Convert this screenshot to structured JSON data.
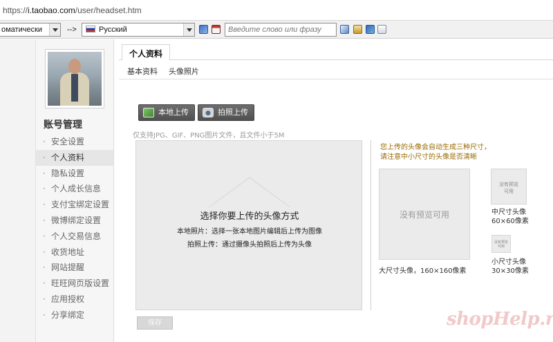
{
  "browser": {
    "url_prefix": "https://",
    "url_domain": "i.taobao.com",
    "url_path": "/user/headset.htm"
  },
  "translator_bar": {
    "source_lang": "оматически",
    "arrow": "-->",
    "target_lang": "Русский",
    "search_placeholder": "Введите слово или фразу"
  },
  "sidebar": {
    "title": "账号管理",
    "items": [
      {
        "label": "安全设置",
        "active": false
      },
      {
        "label": "个人资料",
        "active": true
      },
      {
        "label": "隐私设置",
        "active": false
      },
      {
        "label": "个人成长信息",
        "active": false
      },
      {
        "label": "支付宝绑定设置",
        "active": false
      },
      {
        "label": "微博绑定设置",
        "active": false
      },
      {
        "label": "个人交易信息",
        "active": false
      },
      {
        "label": "收货地址",
        "active": false
      },
      {
        "label": "网站提醒",
        "active": false
      },
      {
        "label": "旺旺网页版设置",
        "active": false
      },
      {
        "label": "应用授权",
        "active": false
      },
      {
        "label": "分享绑定",
        "active": false
      }
    ]
  },
  "main": {
    "tab": "个人资料",
    "subtabs": [
      "基本资料",
      "头像照片"
    ],
    "buttons": {
      "local_upload": "本地上传",
      "camera_upload": "拍照上传",
      "save": "保存"
    },
    "hint": "仅支持JPG、GIF、PNG图片文件，且文件小于5M",
    "upload_area": {
      "title": "选择你要上传的头像方式",
      "line1": "本地照片：选择一张本地图片编辑后上传为图像",
      "line2": "拍照上传：通过摄像头拍照后上传为头像"
    },
    "preview": {
      "note_line1": "您上传的头像会自动生成三种尺寸，",
      "note_line2": "请注意中小尺寸的头像是否清晰",
      "no_preview": "没有预览可用",
      "big_label": "大尺寸头像，160×160像素",
      "mid_label_1": "中尺寸头像",
      "mid_label_2": "60×60像素",
      "small_label_1": "小尺寸头像",
      "small_label_2": "30×30像素",
      "mid_no_preview_1": "没有预览",
      "mid_no_preview_2": "可用",
      "small_no_preview_1": "没有预览",
      "small_no_preview_2": "可用"
    }
  },
  "watermark": "shopHelp.ru",
  "colors": {
    "note_text": "#996b00",
    "button_dark": "#5a5a5a",
    "watermark": "#f1c9c9"
  }
}
